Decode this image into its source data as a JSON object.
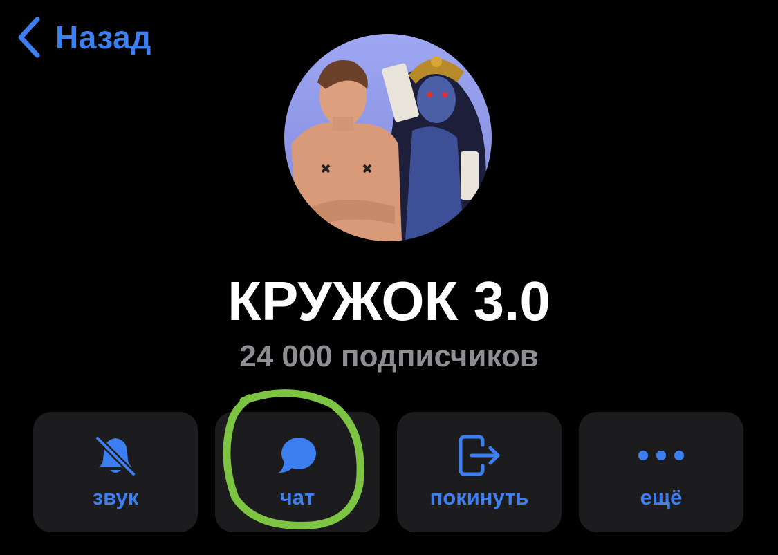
{
  "nav": {
    "back_label": "Назад",
    "back_icon": "chevron-left-icon"
  },
  "channel": {
    "avatar_icon": "channel-avatar",
    "title": "КРУЖОК 3.0",
    "subscribers": "24 000 подписчиков"
  },
  "actions": [
    {
      "label": "звук",
      "icon": "bell-slash-icon"
    },
    {
      "label": "чат",
      "icon": "chat-bubble-icon"
    },
    {
      "label": "покинуть",
      "icon": "leave-icon"
    },
    {
      "label": "ещё",
      "icon": "more-dots-icon"
    }
  ],
  "colors": {
    "background": "#000000",
    "accent": "#3d7ff0",
    "button_bg": "#1c1c1e",
    "secondary_text": "#8e8e93",
    "highlight": "#7cc441"
  }
}
